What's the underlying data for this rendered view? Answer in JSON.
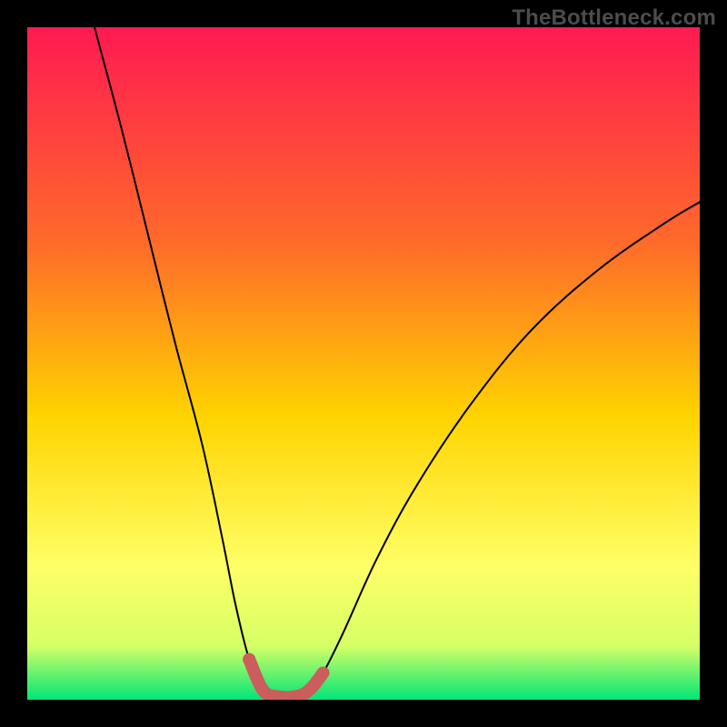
{
  "watermark": "TheBottleneck.com",
  "gradient_colors": {
    "top": "#ff1a52",
    "mid_upper": "#ff6a2a",
    "mid": "#ffd400",
    "mid_lower": "#ffff66",
    "near_bottom": "#d6ff66",
    "bottom": "#00e676"
  },
  "chart_data": {
    "type": "line",
    "title": "",
    "xlabel": "",
    "ylabel": "",
    "xlim": [
      0,
      100
    ],
    "ylim": [
      0,
      100
    ],
    "series": [
      {
        "name": "bottleneck-curve",
        "points_xy": [
          [
            10,
            100
          ],
          [
            14,
            85
          ],
          [
            18,
            69
          ],
          [
            22,
            53
          ],
          [
            26,
            38
          ],
          [
            29,
            24
          ],
          [
            31,
            14
          ],
          [
            33,
            6
          ],
          [
            35,
            1.5
          ],
          [
            37,
            0.5
          ],
          [
            40,
            0.5
          ],
          [
            42,
            1.5
          ],
          [
            44,
            4
          ],
          [
            47,
            10
          ],
          [
            52,
            21
          ],
          [
            58,
            32
          ],
          [
            66,
            44
          ],
          [
            75,
            55
          ],
          [
            85,
            64
          ],
          [
            95,
            71
          ],
          [
            100,
            74
          ]
        ],
        "color_thin": "#000000",
        "stroke_width_thin": 2
      },
      {
        "name": "sweet-spot-highlight",
        "points_xy": [
          [
            33,
            6
          ],
          [
            35,
            1.5
          ],
          [
            37,
            0.5
          ],
          [
            40,
            0.5
          ],
          [
            42,
            1.5
          ],
          [
            44,
            4
          ]
        ],
        "color_thick": "#cc5d5d",
        "stroke_width_thick": 14
      }
    ],
    "dot": {
      "x": 33,
      "y": 6,
      "r": 7,
      "color": "#cc5d5d"
    }
  }
}
